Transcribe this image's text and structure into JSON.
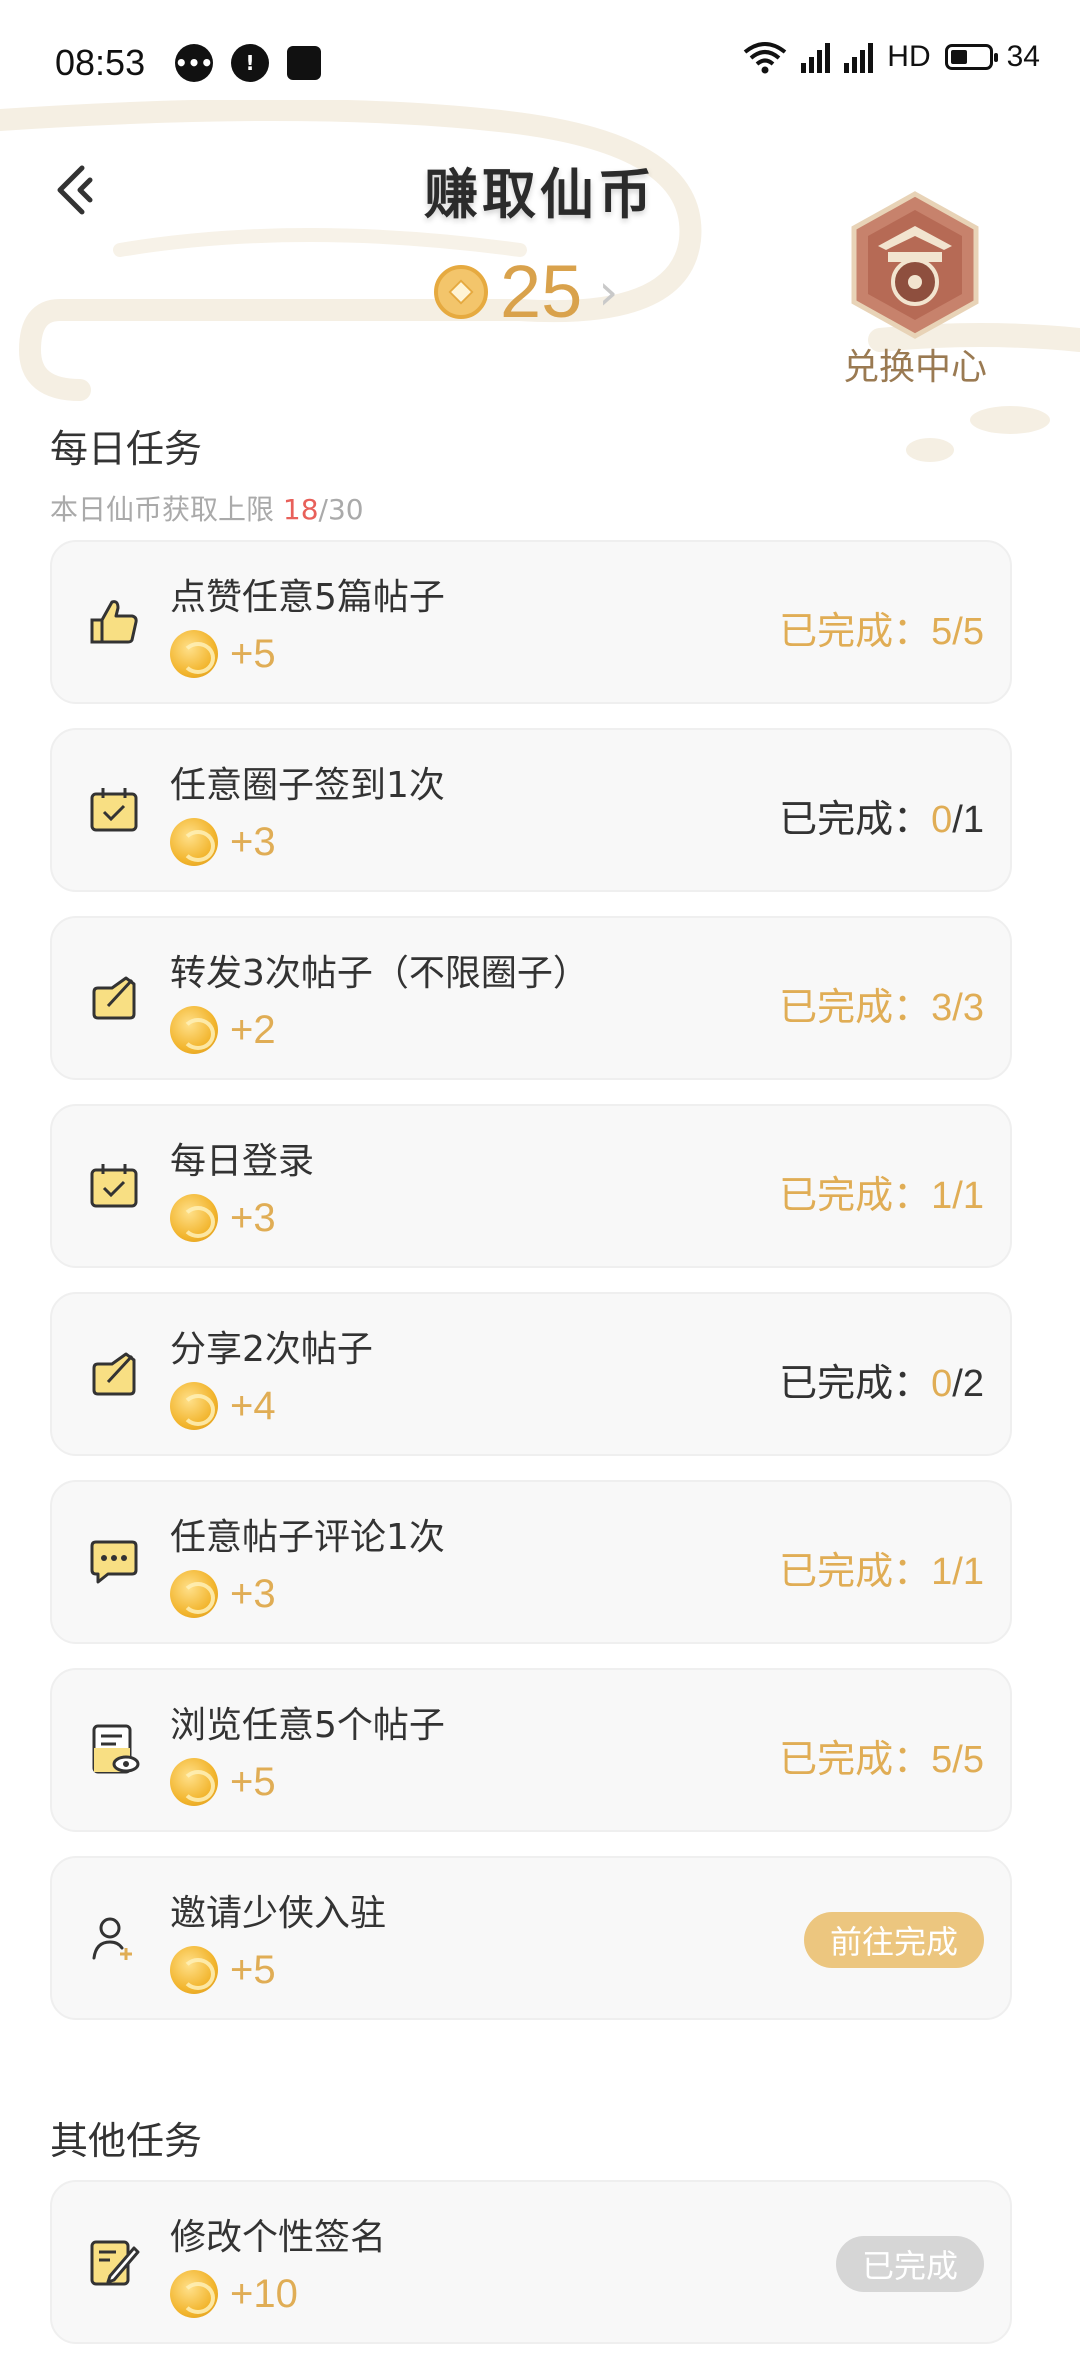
{
  "status_bar": {
    "time": "08:53",
    "network": "HD",
    "battery": "34"
  },
  "header": {
    "title": "赚取仙币",
    "balance": "25",
    "exchange_label": "兑换中心"
  },
  "daily": {
    "title": "每日任务",
    "limit_prefix": "本日仙币获取上限 ",
    "limit_current": "18",
    "limit_suffix": "/30",
    "tasks": [
      {
        "name": "点赞任意5篇帖子",
        "reward": "+5",
        "status": "已完成：5/5",
        "icon": "thumbs-up-icon"
      },
      {
        "name": "任意圈子签到1次",
        "reward": "+3",
        "status_label": "已完成：",
        "status_cur": "0",
        "status_total": "/1",
        "icon": "calendar-check-icon"
      },
      {
        "name": "转发3次帖子（不限圈子）",
        "reward": "+2",
        "status": "已完成：3/3",
        "icon": "share-edit-icon"
      },
      {
        "name": "每日登录",
        "reward": "+3",
        "status": "已完成：1/1",
        "icon": "calendar-check-icon"
      },
      {
        "name": "分享2次帖子",
        "reward": "+4",
        "status_label": "已完成：",
        "status_cur": "0",
        "status_total": "/2",
        "icon": "share-edit-icon"
      },
      {
        "name": "任意帖子评论1次",
        "reward": "+3",
        "status": "已完成：1/1",
        "icon": "comment-icon"
      },
      {
        "name": "浏览任意5个帖子",
        "reward": "+5",
        "status": "已完成：5/5",
        "icon": "document-view-icon"
      },
      {
        "name": "邀请少侠入驻",
        "reward": "+5",
        "action": "前往完成",
        "icon": "invite-user-icon"
      }
    ]
  },
  "other": {
    "title": "其他任务",
    "tasks": [
      {
        "name": "修改个性签名",
        "reward": "+10",
        "action": "已完成",
        "icon": "edit-signature-icon"
      }
    ]
  },
  "colors": {
    "accent_gold": "#e0ad55",
    "highlight_red": "#e8605a",
    "card_bg": "#f8f8f8"
  }
}
